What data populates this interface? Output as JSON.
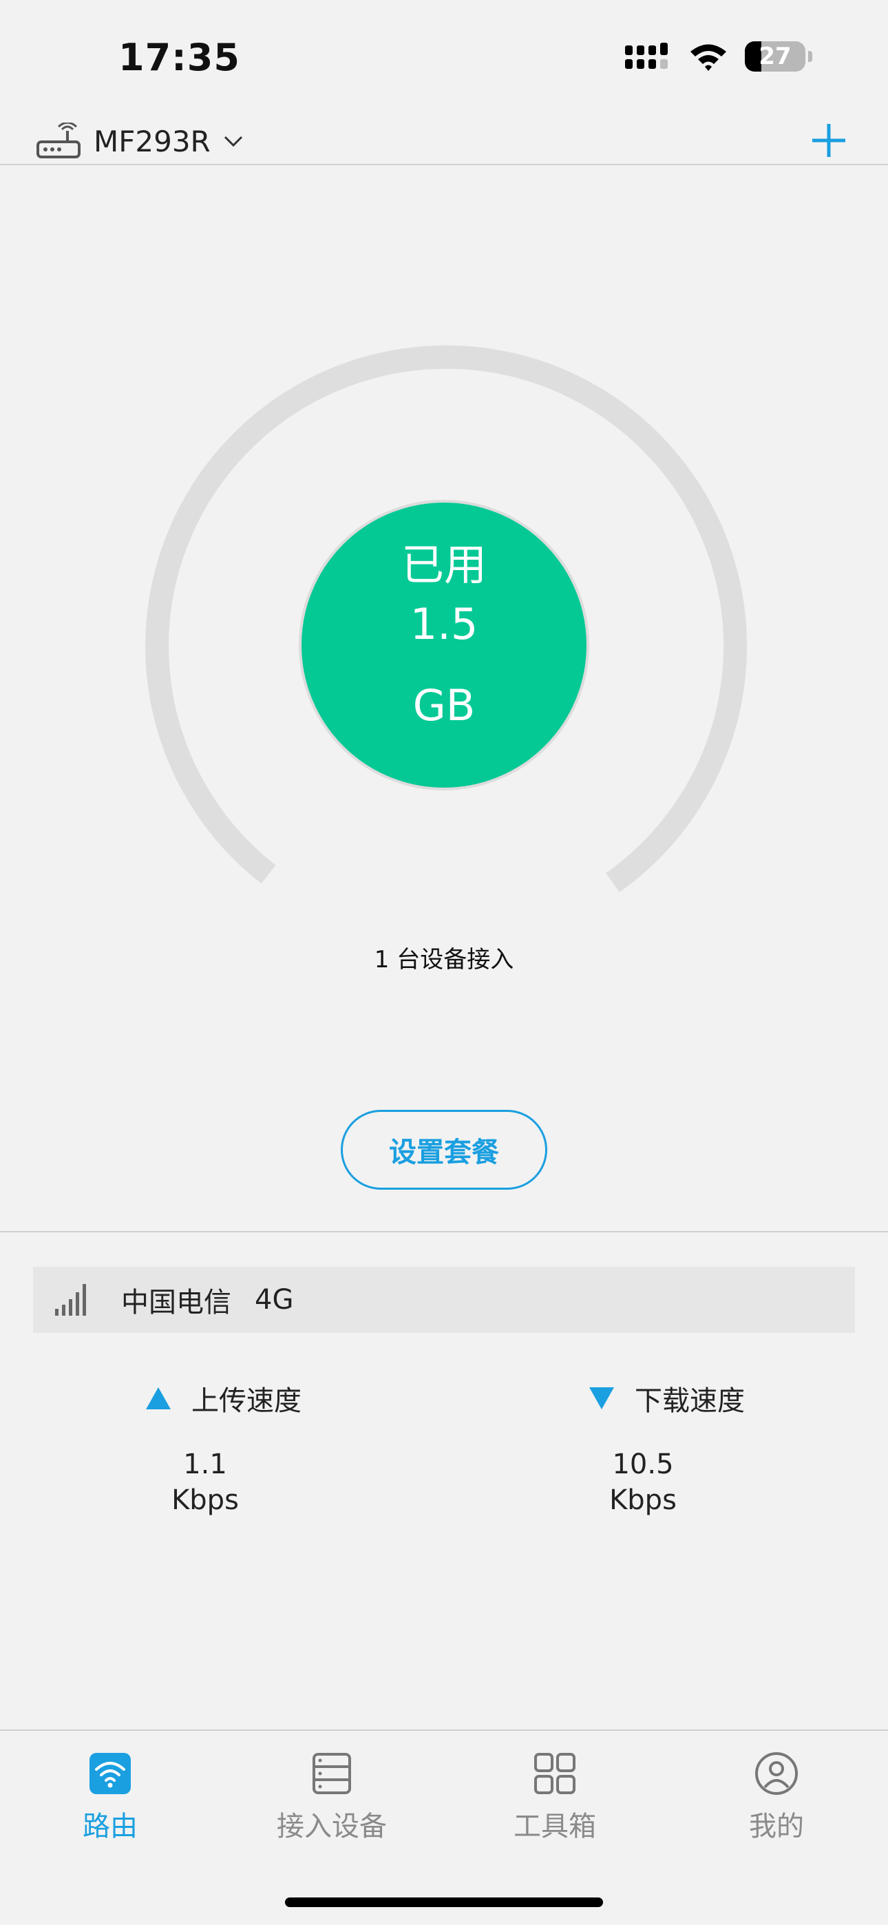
{
  "status_bar": {
    "time": "17:35",
    "battery": "27"
  },
  "header": {
    "router_name": "MF293R"
  },
  "usage": {
    "label": "已用",
    "value": "1.5",
    "unit": "GB",
    "progress_fraction": 0.0
  },
  "devices_text": "1 台设备接入",
  "plan_button_label": "设置套餐",
  "carrier": {
    "name": "中国电信",
    "network": "4G"
  },
  "speeds": {
    "upload": {
      "title": "上传速度",
      "value": "1.1",
      "unit": "Kbps"
    },
    "download": {
      "title": "下载速度",
      "value": "10.5",
      "unit": "Kbps"
    }
  },
  "tabs": [
    {
      "label": "路由",
      "icon": "wifi-router-icon",
      "active": true
    },
    {
      "label": "接入设备",
      "icon": "devices-list-icon",
      "active": false
    },
    {
      "label": "工具箱",
      "icon": "grid-toolbox-icon",
      "active": false
    },
    {
      "label": "我的",
      "icon": "user-profile-icon",
      "active": false
    }
  ],
  "colors": {
    "accent": "#1a9fe0",
    "usage_green": "#04c995",
    "track": "#dedede"
  }
}
